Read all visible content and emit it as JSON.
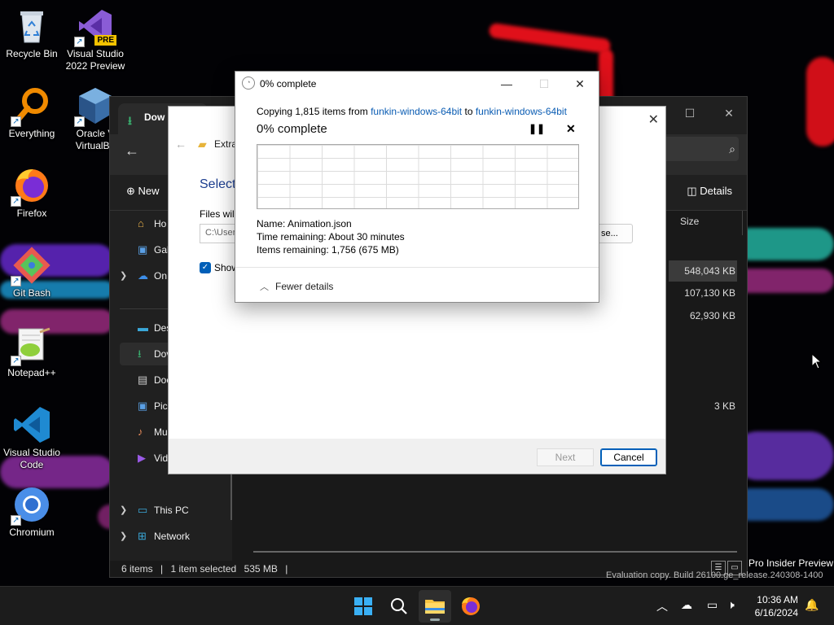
{
  "desktop": {
    "icons": [
      {
        "label": "Recycle Bin",
        "icon": "recycle-bin-icon"
      },
      {
        "label": "Visual Studio 2022 Preview",
        "icon": "visual-studio-icon",
        "badge": "PRE"
      },
      {
        "label": "Everything",
        "icon": "everything-search-icon"
      },
      {
        "label": "Oracle VM VirtualBox",
        "icon": "virtualbox-icon",
        "line1": "Oracle V",
        "line2": "VirtualBo"
      },
      {
        "label": "Firefox",
        "icon": "firefox-icon"
      },
      {
        "label": "Git Bash",
        "icon": "git-bash-icon"
      },
      {
        "label": "Notepad++",
        "icon": "notepad-plus-plus-icon"
      },
      {
        "label": "Visual Studio Code",
        "icon": "vscode-icon"
      },
      {
        "label": "Chromium",
        "icon": "chromium-icon"
      }
    ]
  },
  "explorer": {
    "tab_title": "Dow",
    "new_label": "New",
    "details_label": "Details",
    "size_column": "Size",
    "nav": [
      {
        "label": "Ho",
        "icon": "home-icon"
      },
      {
        "label": "Gal",
        "icon": "gallery-icon"
      },
      {
        "label": "On",
        "icon": "onedrive-icon"
      },
      {
        "label": "Des",
        "icon": "desktop-folder-icon"
      },
      {
        "label": "Dov",
        "icon": "downloads-folder-icon"
      },
      {
        "label": "Doc",
        "icon": "documents-folder-icon"
      },
      {
        "label": "Pic",
        "icon": "pictures-folder-icon"
      },
      {
        "label": "Mu",
        "icon": "music-folder-icon"
      },
      {
        "label": "Vid",
        "icon": "videos-folder-icon"
      },
      {
        "label": "This PC",
        "icon": "this-pc-icon"
      },
      {
        "label": "Network",
        "icon": "network-icon"
      }
    ],
    "sizes": [
      "548,043 KB",
      "107,130 KB",
      "62,930 KB",
      "3 KB"
    ],
    "status": {
      "items": "6 items",
      "selected": "1 item selected",
      "selected_size": "535 MB"
    }
  },
  "wizard": {
    "title_prefix": "Extra",
    "heading": "Select",
    "files_label": "Files will",
    "path_value": "C:\\User",
    "browse_label": "se...",
    "checkbox_label": "Show",
    "next_label": "Next",
    "cancel_label": "Cancel"
  },
  "progress": {
    "window_title": "0% complete",
    "copying_prefix": "Copying 1,815 items from",
    "source": "funkin-windows-64bit",
    "to_word": "to",
    "destination": "funkin-windows-64bit",
    "percent_text": "0% complete",
    "percent_value": 0,
    "name_line": "Name:  Animation.json",
    "time_line": "Time remaining:  About 30 minutes",
    "items_line": "Items remaining:  1,756 (675 MB)",
    "fewer_details": "Fewer details"
  },
  "watermark": {
    "line1": "Pro Insider Preview",
    "line2": "Evaluation copy. Build 26100.ge_release.240308-1400"
  },
  "taskbar": {
    "apps": [
      {
        "name": "start-button",
        "icon": "windows-logo-icon"
      },
      {
        "name": "search-button",
        "icon": "search-icon"
      },
      {
        "name": "file-explorer-button",
        "icon": "folder-icon",
        "active": true
      },
      {
        "name": "firefox-taskbar-button",
        "icon": "firefox-icon"
      }
    ],
    "time": "10:36 AM",
    "date": "6/16/2024"
  },
  "colors": {
    "accent": "#005fb8",
    "link": "#0a5cb3",
    "explorer_bg": "#191919"
  }
}
